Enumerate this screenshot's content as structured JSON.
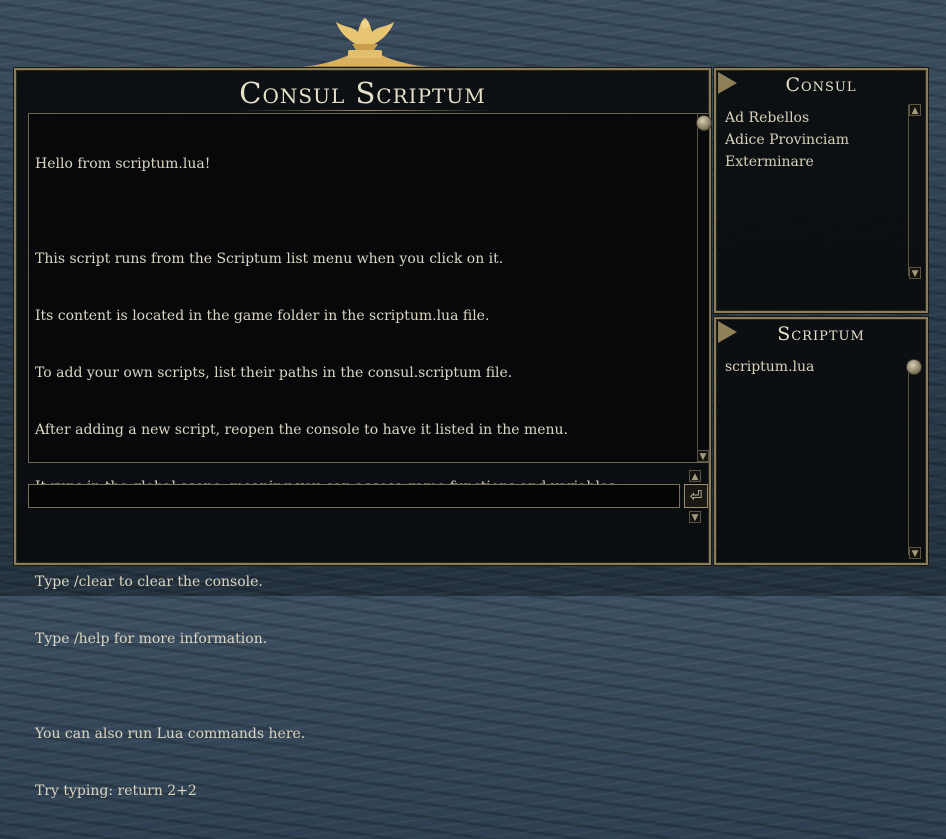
{
  "console": {
    "title": "Consul Scriptum",
    "output_lines": [
      "Hello from scriptum.lua!",
      "",
      "This script runs from the Scriptum list menu when you click on it.",
      "Its content is located in the game folder in the scriptum.lua file.",
      "To add your own scripts, list their paths in the consul.scriptum file.",
      "After adding a new script, reopen the console to have it listed in the menu.",
      "It runs in the global scope, meaning you can access game functions and variables.",
      "",
      "Type /clear to clear the console.",
      "Type /help for more information.",
      "",
      "You can also run Lua commands here.",
      "Try typing: return 2+2"
    ],
    "input_value": "",
    "run_icon": "enter-icon"
  },
  "consul_panel": {
    "title": "Consul",
    "items": [
      "Ad Rebellos",
      "Adice Provinciam",
      "Exterminare"
    ]
  },
  "scriptum_panel": {
    "title": "Scriptum",
    "items": [
      "scriptum.lua"
    ]
  },
  "colors": {
    "border_gold": "#8a7d5c",
    "text": "#dcd5c1",
    "title_text": "#e6dfc9"
  }
}
